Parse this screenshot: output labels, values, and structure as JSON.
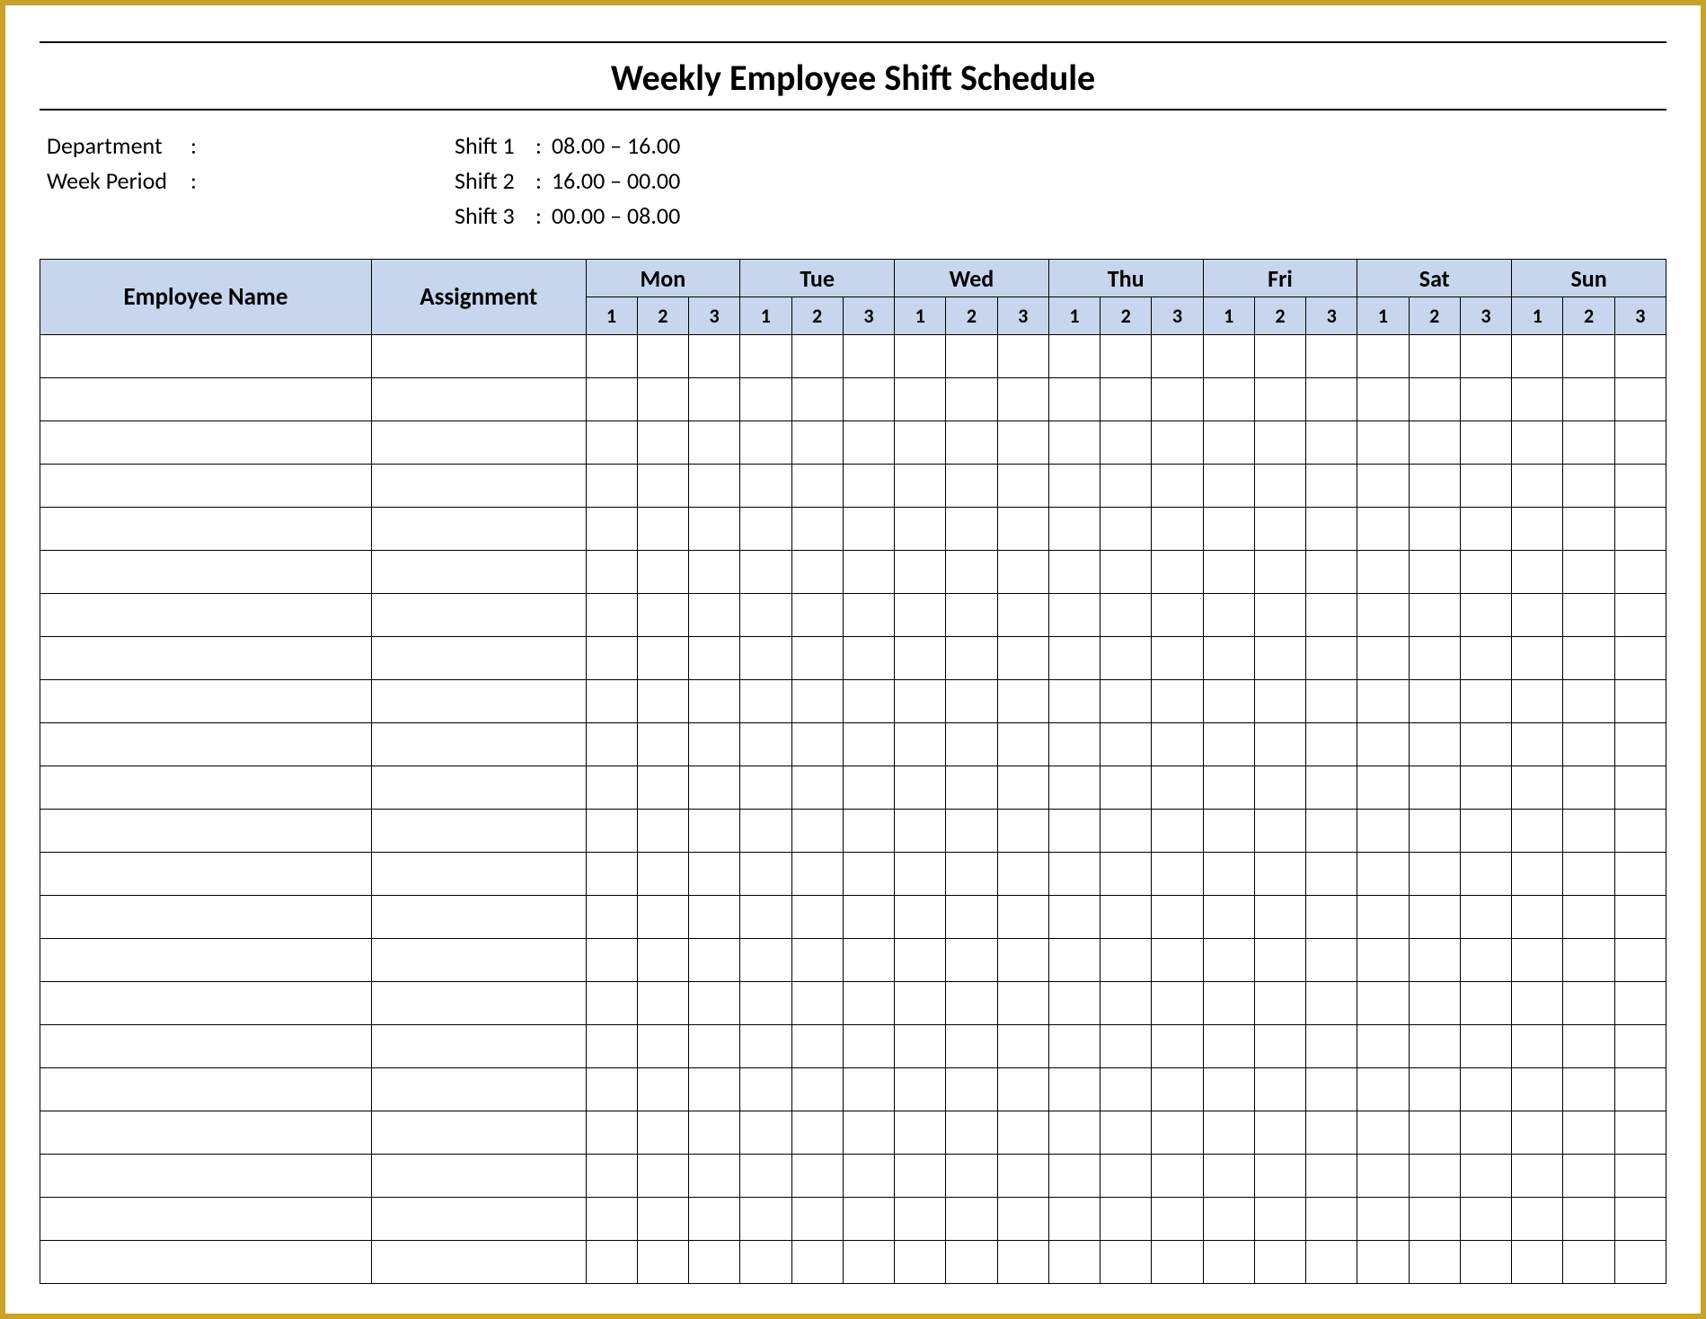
{
  "title": "Weekly Employee Shift Schedule",
  "meta": {
    "department_label": "Department",
    "week_period_label": "Week  Period",
    "shifts": [
      {
        "label": "Shift 1",
        "time": "08.00  –  16.00"
      },
      {
        "label": "Shift 2",
        "time": "16.00  –  00.00"
      },
      {
        "label": "Shift 3",
        "time": "00.00  –  08.00"
      }
    ]
  },
  "table": {
    "employee_name_header": "Employee Name",
    "assignment_header": "Assignment",
    "days": [
      "Mon",
      "Tue",
      "Wed",
      "Thu",
      "Fri",
      "Sat",
      "Sun"
    ],
    "shift_numbers": [
      "1",
      "2",
      "3"
    ],
    "row_count": 22
  }
}
